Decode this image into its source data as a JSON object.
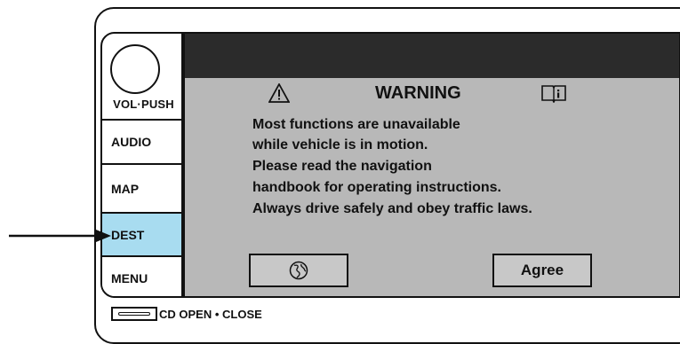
{
  "side_panel": {
    "knob_label": "VOL·PUSH",
    "buttons": [
      {
        "label": "AUDIO",
        "active": false
      },
      {
        "label": "MAP",
        "active": false
      },
      {
        "label": "DEST",
        "active": true
      },
      {
        "label": "MENU",
        "active": false
      }
    ]
  },
  "dialog": {
    "title": "WARNING",
    "icons": {
      "left": "warning-icon",
      "right": "book-icon"
    },
    "lines": [
      "Most functions are unavailable",
      "while vehicle is in motion.",
      "Please read the navigation",
      "handbook for operating instructions.",
      "Always drive safely and obey traffic laws."
    ],
    "language_button_icon": "globe-icon",
    "agree_label": "Agree"
  },
  "bottom": {
    "cd_label": "CD OPEN • CLOSE"
  },
  "colors": {
    "screen_bg": "#b8b8b8",
    "topbar": "#2b2b2b",
    "active_button": "#a8dcf0"
  }
}
